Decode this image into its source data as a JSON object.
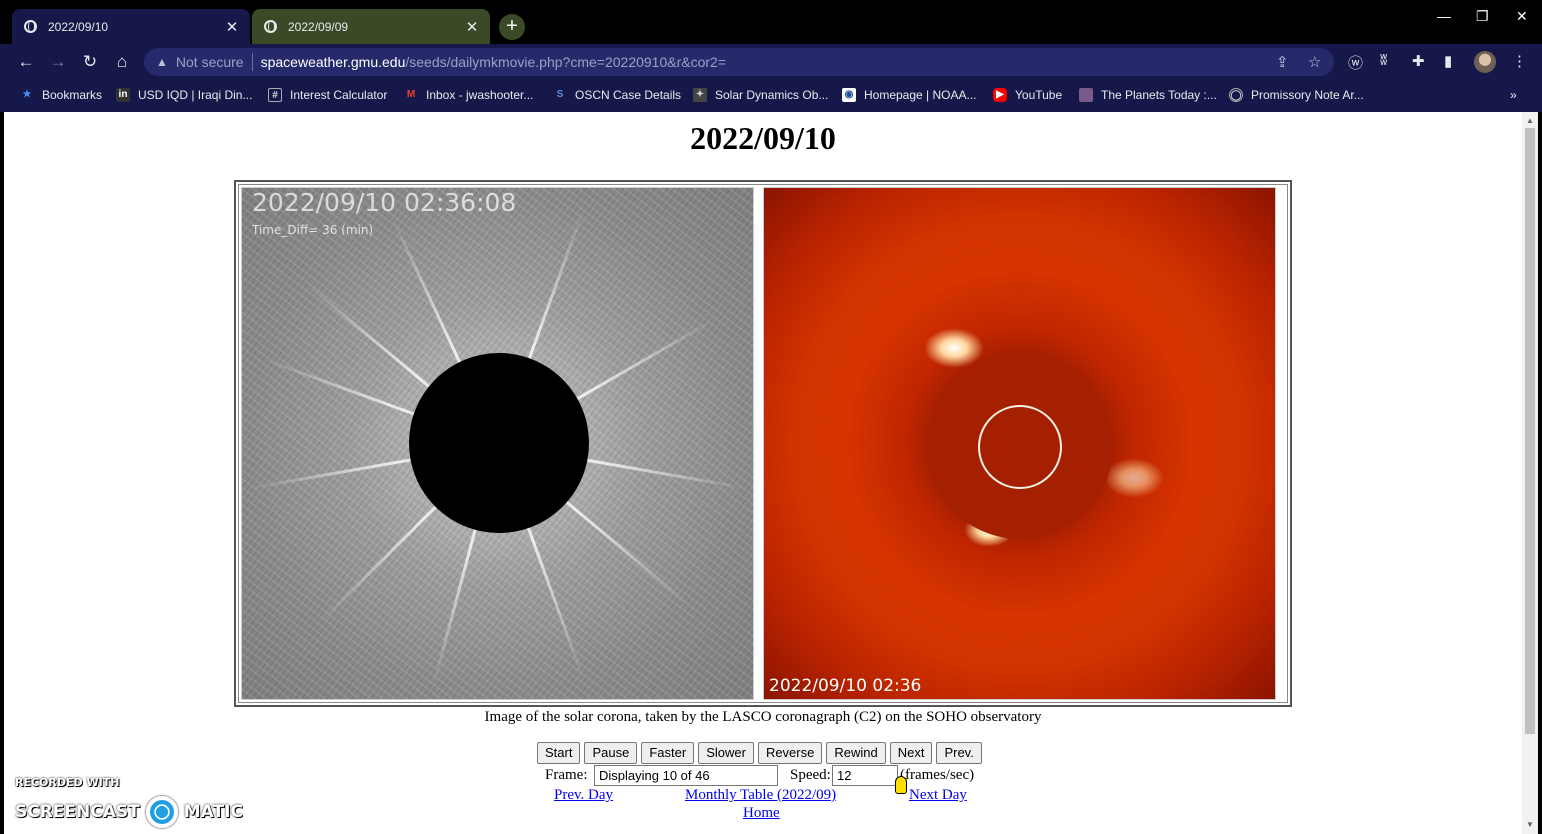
{
  "browser": {
    "tabs": [
      {
        "title": "2022/09/10",
        "active": true
      },
      {
        "title": "2022/09/09",
        "active": false
      }
    ],
    "new_tab": "+",
    "address": {
      "security_label": "Not secure",
      "host": "spaceweather.gmu.edu",
      "path": "/seeds/dailymkmovie.php?cme=20220910&r&cor2="
    },
    "bookmarks": [
      {
        "label": "Bookmarks",
        "icon": "star-icon"
      },
      {
        "label": "USD IQD | Iraqi Din...",
        "icon": "inv-icon"
      },
      {
        "label": "Interest Calculator",
        "icon": "calculator-icon"
      },
      {
        "label": "Inbox - jwashooter...",
        "icon": "gmail-icon"
      },
      {
        "label": "OSCN Case Details",
        "icon": "oscn-icon"
      },
      {
        "label": "Solar Dynamics Ob...",
        "icon": "sdo-icon"
      },
      {
        "label": "Homepage | NOAA...",
        "icon": "noaa-icon"
      },
      {
        "label": "YouTube",
        "icon": "youtube-icon"
      },
      {
        "label": "The Planets Today :...",
        "icon": "planets-icon"
      },
      {
        "label": "Promissory Note Ar...",
        "icon": "doc-icon"
      }
    ],
    "bookmarks_overflow": "»"
  },
  "page": {
    "title": "2022/09/10",
    "left_image": {
      "timestamp": "2022/09/10  02:36:08",
      "time_diff": "Time_Diff=  36  (min)"
    },
    "right_image": {
      "timestamp": "2022/09/10 02:36"
    },
    "caption": "Image of the solar corona, taken by the LASCO coronagraph (C2) on the SOHO observatory",
    "buttons": [
      "Start",
      "Pause",
      "Faster",
      "Slower",
      "Reverse",
      "Rewind",
      "Next",
      "Prev."
    ],
    "frame_label": "Frame:",
    "frame_value": "Displaying 10 of 46",
    "speed_label": "Speed:",
    "speed_value": "12",
    "speed_unit": "(frames/sec)",
    "links": {
      "prev_day": "Prev. Day",
      "monthly": "Monthly Table (2022/09)",
      "next_day": "Next Day",
      "home": "Home"
    }
  },
  "watermark": {
    "line1": "RECORDED WITH",
    "line2a": "SCREENCAST",
    "line2b": "MATIC"
  }
}
